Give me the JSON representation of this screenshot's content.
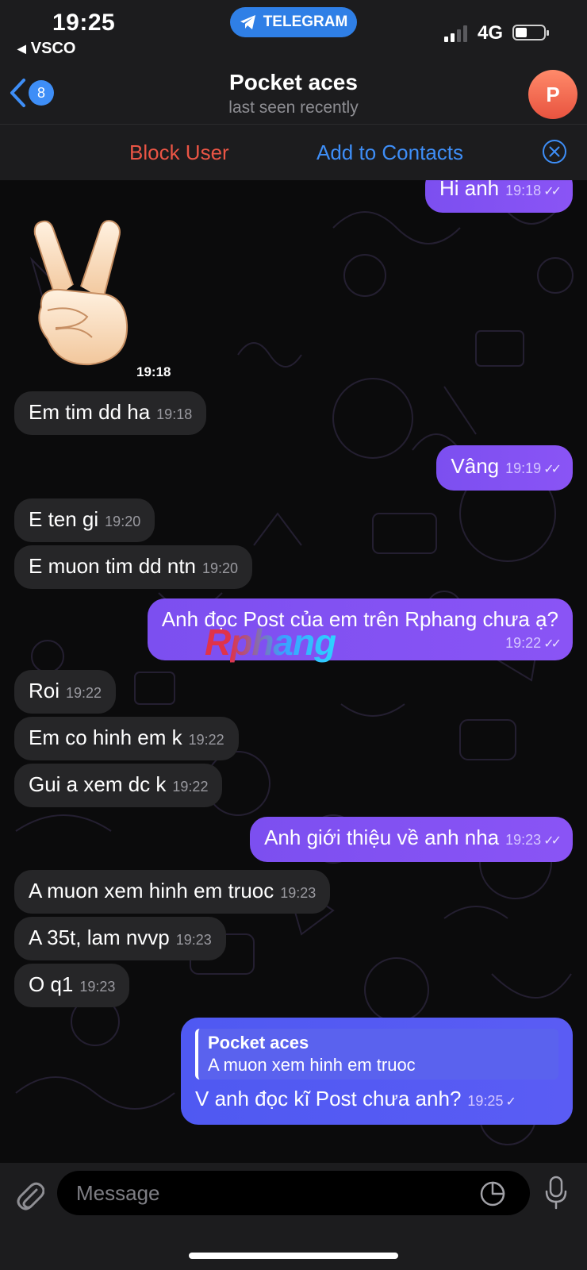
{
  "status_bar": {
    "time": "19:25",
    "back_app": "VSCO",
    "pill_label": "TELEGRAM",
    "network": "4G"
  },
  "header": {
    "unread_count": "8",
    "title": "Pocket aces",
    "subtitle": "last seen recently",
    "avatar_letter": "P"
  },
  "actions": {
    "block": "Block User",
    "add": "Add to Contacts"
  },
  "watermark": {
    "first": "R",
    "rest": "phang"
  },
  "messages": [
    {
      "dir": "out",
      "text": "Hi anh",
      "time": "19:18",
      "status": "read"
    },
    {
      "dir": "in",
      "type": "sticker",
      "emoji": "✌️",
      "time": "19:18"
    },
    {
      "dir": "in",
      "text": "Em tim dd ha",
      "time": "19:18"
    },
    {
      "dir": "out",
      "text": "Vâng",
      "time": "19:19",
      "status": "read"
    },
    {
      "dir": "in",
      "text": "E ten gi",
      "time": "19:20"
    },
    {
      "dir": "in",
      "text": "E muon tim dd ntn",
      "time": "19:20"
    },
    {
      "dir": "out",
      "text": "Anh đọc Post của em trên Rphang chưa ạ?",
      "time": "19:22",
      "status": "read"
    },
    {
      "dir": "in",
      "text": "Roi",
      "time": "19:22"
    },
    {
      "dir": "in",
      "text": "Em co hinh em k",
      "time": "19:22"
    },
    {
      "dir": "in",
      "text": "Gui a xem dc k",
      "time": "19:22"
    },
    {
      "dir": "out",
      "text": "Anh giới thiệu về anh nha",
      "time": "19:23",
      "status": "read"
    },
    {
      "dir": "in",
      "text": "A muon xem hinh em truoc",
      "time": "19:23"
    },
    {
      "dir": "in",
      "text": "A 35t, lam nvvp",
      "time": "19:23"
    },
    {
      "dir": "in",
      "text": "O q1",
      "time": "19:23"
    },
    {
      "dir": "out",
      "reply_to": {
        "name": "Pocket aces",
        "text": "A muon xem hinh em truoc"
      },
      "text": "V anh đọc kĩ Post chưa anh?",
      "time": "19:25",
      "status": "sent"
    }
  ],
  "input": {
    "placeholder": "Message"
  },
  "colors": {
    "outgoing": "#8a54f5",
    "reply_bubble": "#5059f0",
    "incoming": "#262628",
    "accent": "#3e8ef7",
    "danger": "#eb5545"
  },
  "icons": [
    "vsco-back-icon",
    "telegram-icon",
    "signal-icon",
    "battery-icon",
    "back-chevron-icon",
    "close-circle-icon",
    "attach-icon",
    "sticker-icon",
    "mic-icon"
  ]
}
